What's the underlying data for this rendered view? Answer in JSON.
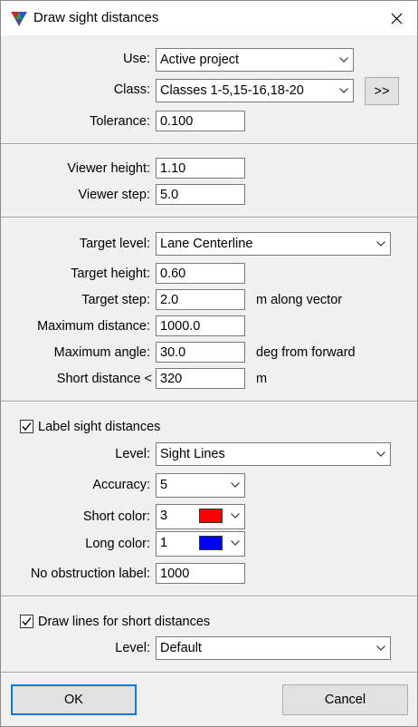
{
  "window": {
    "title": "Draw sight distances",
    "close_glyph": "✕"
  },
  "section1": {
    "use_label": "Use:",
    "use_value": "Active project",
    "class_label": "Class:",
    "class_value": "Classes 1-5,15-16,18-20",
    "more_button": ">>",
    "tolerance_label": "Tolerance:",
    "tolerance_value": "0.100"
  },
  "section2": {
    "viewer_height_label": "Viewer height:",
    "viewer_height_value": "1.10",
    "viewer_step_label": "Viewer step:",
    "viewer_step_value": "5.0"
  },
  "section3": {
    "target_level_label": "Target level:",
    "target_level_value": "Lane Centerline",
    "target_height_label": "Target height:",
    "target_height_value": "0.60",
    "target_step_label": "Target step:",
    "target_step_value": "2.0",
    "target_step_unit": "m along vector",
    "max_distance_label": "Maximum distance:",
    "max_distance_value": "1000.0",
    "max_angle_label": "Maximum angle:",
    "max_angle_value": "30.0",
    "max_angle_unit": "deg from forward",
    "short_distance_label": "Short distance <",
    "short_distance_value": "320",
    "short_distance_unit": "m"
  },
  "section4": {
    "label_checkbox": "Label sight distances",
    "level_label": "Level:",
    "level_value": "Sight Lines",
    "accuracy_label": "Accuracy:",
    "accuracy_value": "5",
    "short_color_label": "Short color:",
    "short_color_value": "3",
    "short_color_hex": "#ff0000",
    "long_color_label": "Long color:",
    "long_color_value": "1",
    "long_color_hex": "#0000ff",
    "no_obstruction_label": "No obstruction label:",
    "no_obstruction_value": "1000"
  },
  "section5": {
    "draw_checkbox": "Draw lines for short distances",
    "level_label": "Level:",
    "level_value": "Default"
  },
  "buttons": {
    "ok": "OK",
    "cancel": "Cancel"
  }
}
